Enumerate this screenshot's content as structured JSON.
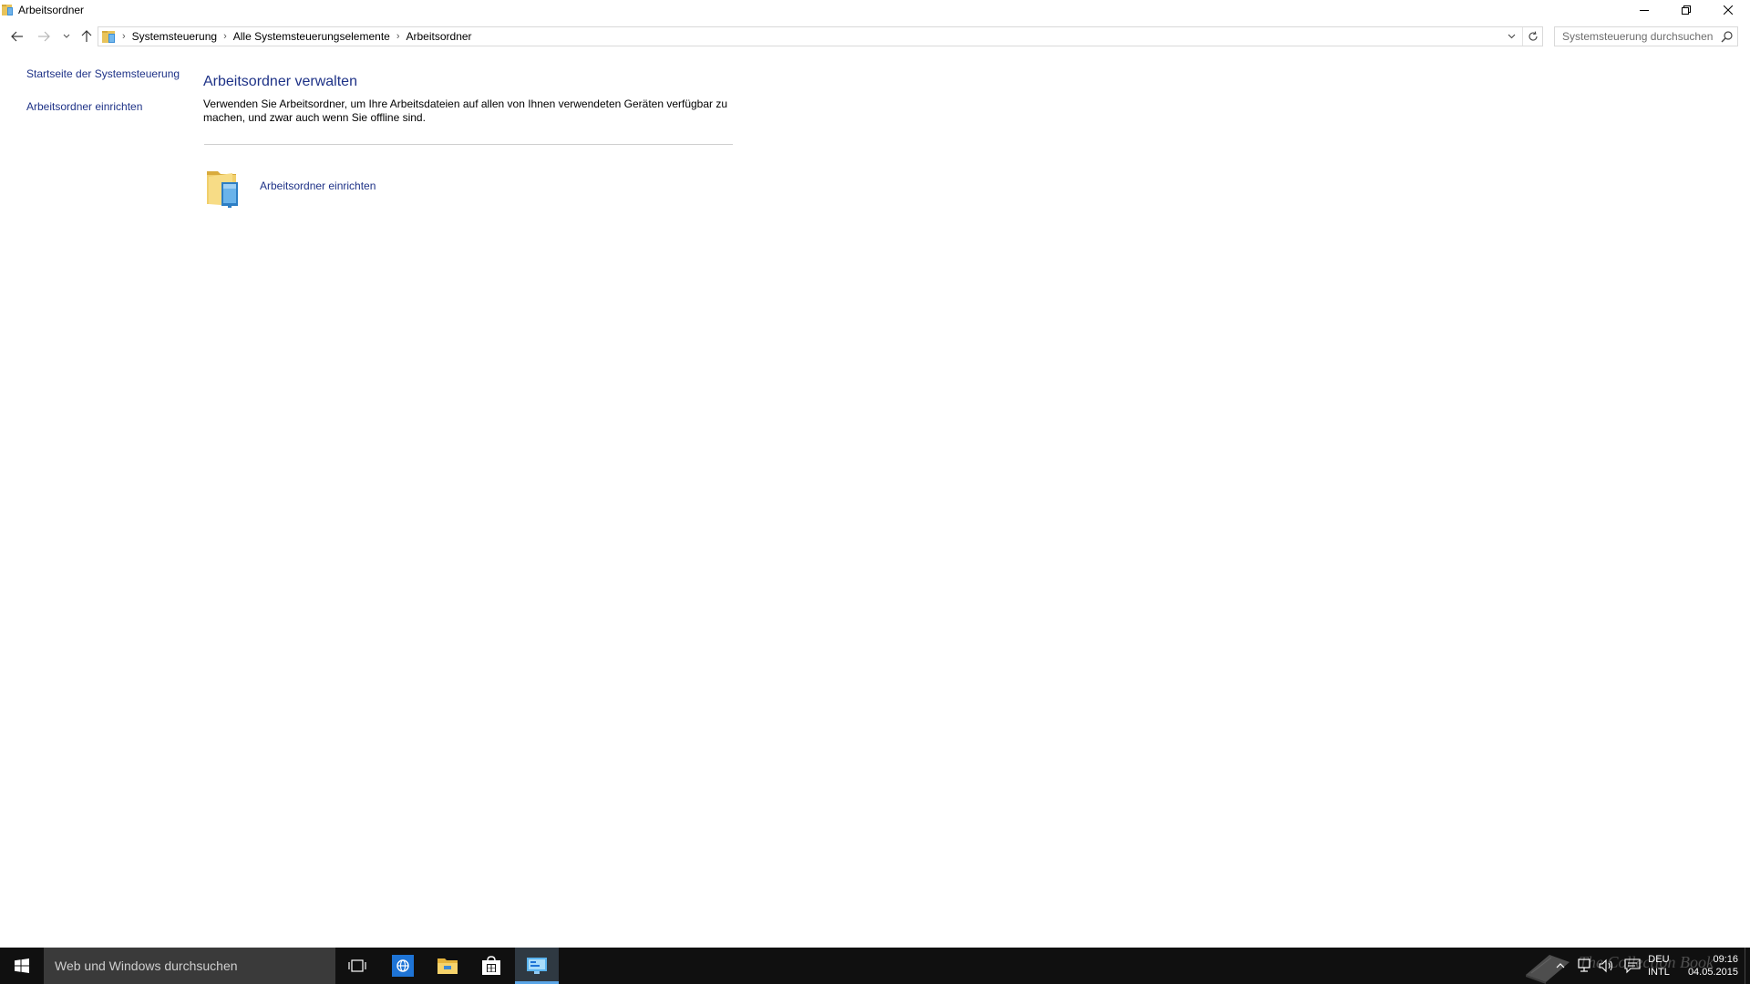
{
  "window": {
    "title": "Arbeitsordner",
    "controls": {
      "minimize": "minimize-icon",
      "restore": "restore-icon",
      "close": "close-icon"
    }
  },
  "navigation": {
    "breadcrumbs": [
      "Systemsteuerung",
      "Alle Systemsteuerungselemente",
      "Arbeitsordner"
    ],
    "search_placeholder": "Systemsteuerung durchsuchen"
  },
  "left_pane": {
    "links": [
      "Startseite der Systemsteuerung",
      "Arbeitsordner einrichten"
    ]
  },
  "main": {
    "title": "Arbeitsordner verwalten",
    "description": "Verwenden Sie Arbeitsordner, um Ihre Arbeitsdateien auf allen von Ihnen verwendeten Geräten verfügbar zu machen, und zwar auch wenn Sie offline sind.",
    "task_link": "Arbeitsordner einrichten"
  },
  "taskbar": {
    "search_placeholder": "Web und Windows durchsuchen",
    "pinned": [
      "task-view-icon",
      "internet-explorer-icon",
      "file-explorer-icon",
      "store-icon",
      "control-panel-icon"
    ],
    "watermark": "The Collection Book",
    "language": {
      "line1": "DEU",
      "line2": "INTL"
    },
    "clock": {
      "time": "09:16",
      "date": "04.05.2015"
    }
  },
  "colors": {
    "link": "#1e3287",
    "taskbar": "#101010",
    "taskbar_search": "#3a3a3a",
    "active_indicator": "#5aa5e6"
  }
}
